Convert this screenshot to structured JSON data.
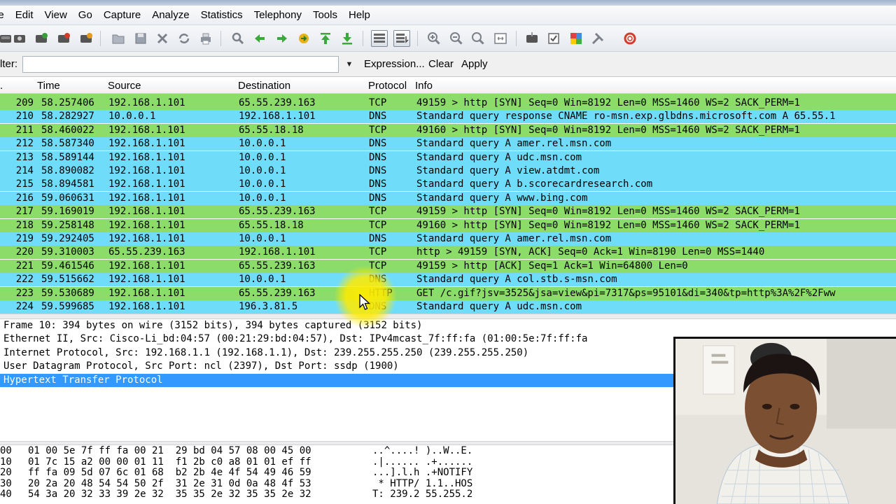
{
  "menu": [
    "le",
    "Edit",
    "View",
    "Go",
    "Capture",
    "Analyze",
    "Statistics",
    "Telephony",
    "Tools",
    "Help"
  ],
  "filter": {
    "label": "lter:",
    "value": "",
    "expression": "Expression...",
    "clear": "Clear",
    "apply": "Apply"
  },
  "columns": {
    "no": ".",
    "time": "Time",
    "source": "Source",
    "destination": "Destination",
    "protocol": "Protocol",
    "info": "Info"
  },
  "colors": {
    "tcp_row": "#8cdc6a",
    "dns_row": "#6fdcfa",
    "selected_detail": "#3399ff",
    "cursor_highlight": "#ffeb00"
  },
  "packets": [
    {
      "no": "209",
      "time": "58.257406",
      "src": "192.168.1.101",
      "dst": "65.55.239.163",
      "proto": "TCP",
      "info": "49159 > http [SYN] Seq=0 Win=8192 Len=0 MSS=1460 WS=2 SACK_PERM=1",
      "color": "#8cdc6a"
    },
    {
      "no": "210",
      "time": "58.282927",
      "src": "10.0.0.1",
      "dst": "192.168.1.101",
      "proto": "DNS",
      "info": "Standard query response CNAME ro-msn.exp.glbdns.microsoft.com A 65.55.1",
      "color": "#6fdcfa"
    },
    {
      "no": "211",
      "time": "58.460022",
      "src": "192.168.1.101",
      "dst": "65.55.18.18",
      "proto": "TCP",
      "info": "49160 > http [SYN] Seq=0 Win=8192 Len=0 MSS=1460 WS=2 SACK_PERM=1",
      "color": "#8cdc6a"
    },
    {
      "no": "212",
      "time": "58.587340",
      "src": "192.168.1.101",
      "dst": "10.0.0.1",
      "proto": "DNS",
      "info": "Standard query A amer.rel.msn.com",
      "color": "#6fdcfa"
    },
    {
      "no": "213",
      "time": "58.589144",
      "src": "192.168.1.101",
      "dst": "10.0.0.1",
      "proto": "DNS",
      "info": "Standard query A udc.msn.com",
      "color": "#6fdcfa"
    },
    {
      "no": "214",
      "time": "58.890082",
      "src": "192.168.1.101",
      "dst": "10.0.0.1",
      "proto": "DNS",
      "info": "Standard query A view.atdmt.com",
      "color": "#6fdcfa"
    },
    {
      "no": "215",
      "time": "58.894581",
      "src": "192.168.1.101",
      "dst": "10.0.0.1",
      "proto": "DNS",
      "info": "Standard query A b.scorecardresearch.com",
      "color": "#6fdcfa"
    },
    {
      "no": "216",
      "time": "59.060631",
      "src": "192.168.1.101",
      "dst": "10.0.0.1",
      "proto": "DNS",
      "info": "Standard query A www.bing.com",
      "color": "#6fdcfa"
    },
    {
      "no": "217",
      "time": "59.169019",
      "src": "192.168.1.101",
      "dst": "65.55.239.163",
      "proto": "TCP",
      "info": "49159 > http [SYN] Seq=0 Win=8192 Len=0 MSS=1460 WS=2 SACK_PERM=1",
      "color": "#8cdc6a"
    },
    {
      "no": "218",
      "time": "59.258148",
      "src": "192.168.1.101",
      "dst": "65.55.18.18",
      "proto": "TCP",
      "info": "49160 > http [SYN] Seq=0 Win=8192 Len=0 MSS=1460 WS=2 SACK_PERM=1",
      "color": "#8cdc6a"
    },
    {
      "no": "219",
      "time": "59.292405",
      "src": "192.168.1.101",
      "dst": "10.0.0.1",
      "proto": "DNS",
      "info": "Standard query A amer.rel.msn.com",
      "color": "#6fdcfa"
    },
    {
      "no": "220",
      "time": "59.310003",
      "src": "65.55.239.163",
      "dst": "192.168.1.101",
      "proto": "TCP",
      "info": "http > 49159 [SYN, ACK] Seq=0 Ack=1 Win=8190 Len=0 MSS=1440",
      "color": "#8cdc6a"
    },
    {
      "no": "221",
      "time": "59.461546",
      "src": "192.168.1.101",
      "dst": "65.55.239.163",
      "proto": "TCP",
      "info": "49159 > http [ACK] Seq=1 Ack=1 Win=64800 Len=0",
      "color": "#8cdc6a"
    },
    {
      "no": "222",
      "time": "59.515662",
      "src": "192.168.1.101",
      "dst": "10.0.0.1",
      "proto": "DNS",
      "info": "Standard query A col.stb.s-msn.com",
      "color": "#6fdcfa"
    },
    {
      "no": "223",
      "time": "59.530689",
      "src": "192.168.1.101",
      "dst": "65.55.239.163",
      "proto": "HTTP",
      "info": "GET /c.gif?jsv=3525&jsa=view&pi=7317&ps=95101&di=340&tp=http%3A%2F%2Fww",
      "color": "#8cdc6a"
    },
    {
      "no": "224",
      "time": "59.599685",
      "src": "192.168.1.101",
      "dst": "196.3.81.5",
      "proto": "DNS",
      "info": "Standard query A udc.msn.com",
      "color": "#6fdcfa"
    }
  ],
  "details": [
    "Frame 10: 394 bytes on wire (3152 bits), 394 bytes captured (3152 bits)",
    "Ethernet II, Src: Cisco-Li_bd:04:57 (00:21:29:bd:04:57), Dst: IPv4mcast_7f:ff:fa (01:00:5e:7f:ff:fa",
    "Internet Protocol, Src: 192.168.1.1 (192.168.1.1), Dst: 239.255.255.250 (239.255.255.250)",
    "User Datagram Protocol, Src Port: ncl (2397), Dst Port: ssdp (1900)",
    "Hypertext Transfer Protocol"
  ],
  "selected_detail_index": 4,
  "bytes": [
    {
      "off": "00",
      "hex": "01 00 5e 7f ff fa 00 21  29 bd 04 57 08 00 45 00",
      "ascii": "..^....! )..W..E."
    },
    {
      "off": "10",
      "hex": "01 7c 15 a2 00 00 01 11  f1 2b c0 a8 01 01 ef ff",
      "ascii": ".|...... .+......"
    },
    {
      "off": "20",
      "hex": "ff fa 09 5d 07 6c 01 68  b2 2b 4e 4f 54 49 46 59",
      "ascii": "...].l.h .+NOTIFY"
    },
    {
      "off": "30",
      "hex": "20 2a 20 48 54 54 50 2f  31 2e 31 0d 0a 48 4f 53",
      "ascii": " * HTTP/ 1.1..HOS"
    },
    {
      "off": "40",
      "hex": "54 3a 20 32 33 39 2e 32  35 35 2e 32 35 35 2e 32",
      "ascii": "T: 239.2 55.255.2"
    }
  ]
}
